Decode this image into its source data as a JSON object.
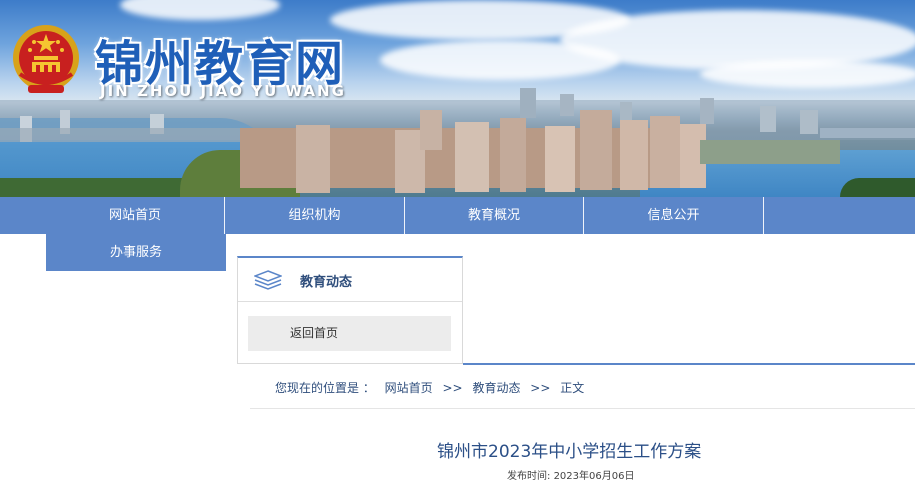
{
  "header": {
    "site_title": "锦州教育网",
    "site_subtitle": "JIN ZHOU JIAO YU WANG",
    "emblem_icon": "national-emblem-icon"
  },
  "nav": {
    "items": [
      {
        "label": "网站首页"
      },
      {
        "label": "组织机构"
      },
      {
        "label": "教育概况"
      },
      {
        "label": "信息公开"
      },
      {
        "label": "办事服务"
      }
    ]
  },
  "sidebar": {
    "title": "教育动态",
    "icon": "layers-icon",
    "link_label": "返回首页"
  },
  "breadcrumb": {
    "prefix": "您现在的位置是 ：",
    "items": [
      "网站首页",
      "教育动态",
      "正文"
    ],
    "separator": ">>"
  },
  "article": {
    "title": "锦州市2023年中小学招生工作方案",
    "published_label": "发布时间:",
    "published_date": "2023年06月06日"
  },
  "colors": {
    "nav_bg": "#5b86c9",
    "title_text": "#2b4f87",
    "site_title": "#1f5fb8"
  }
}
